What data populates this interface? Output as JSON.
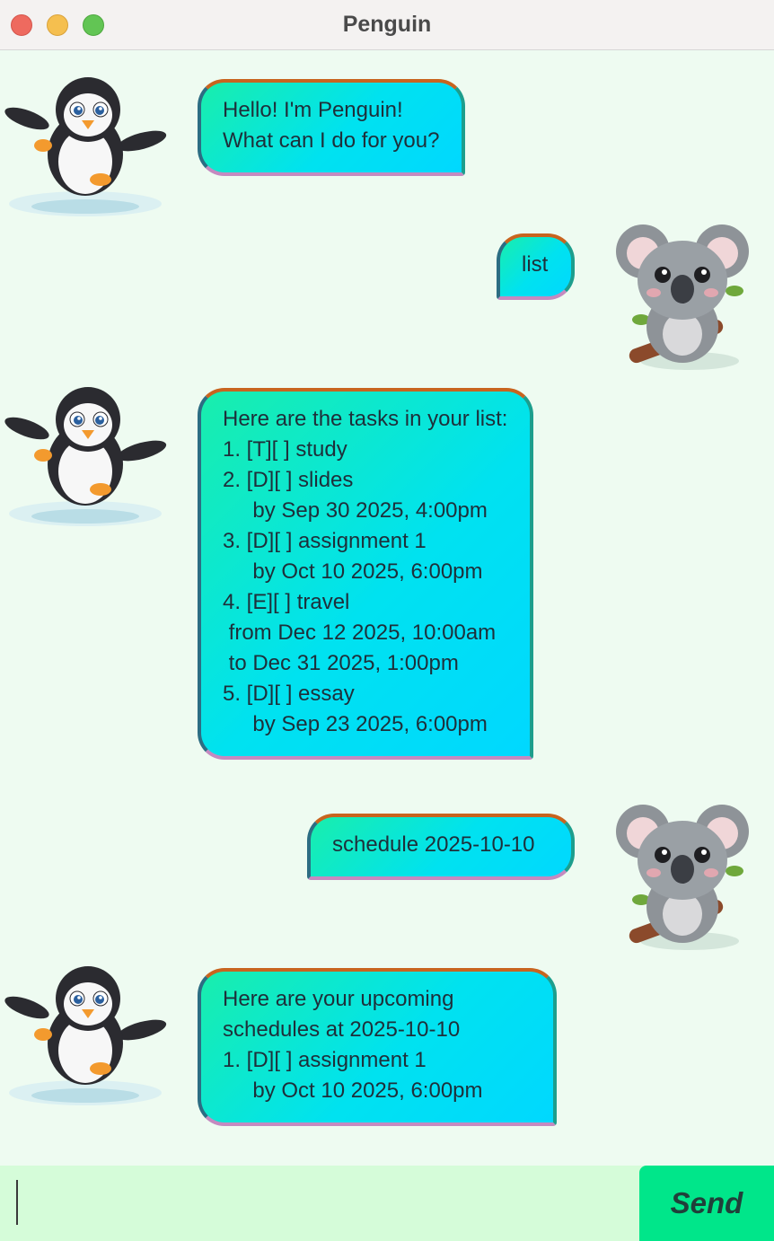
{
  "window": {
    "title": "Penguin"
  },
  "messages": [
    {
      "sender": "bot",
      "text": "Hello! I'm Penguin!\nWhat can I do for you?"
    },
    {
      "sender": "user",
      "text": "list"
    },
    {
      "sender": "bot",
      "text": "Here are the tasks in your list:\n1. [T][ ] study\n2. [D][ ] slides\n     by Sep 30 2025, 4:00pm\n3. [D][ ] assignment 1\n     by Oct 10 2025, 6:00pm\n4. [E][ ] travel\n from Dec 12 2025, 10:00am\n to Dec 31 2025, 1:00pm\n5. [D][ ] essay\n     by Sep 23 2025, 6:00pm"
    },
    {
      "sender": "user",
      "text": "schedule 2025-10-10"
    },
    {
      "sender": "bot",
      "text": "Here are your upcoming\nschedules at 2025-10-10\n1. [D][ ] assignment 1\n     by Oct 10 2025, 6:00pm"
    }
  ],
  "input": {
    "value": "",
    "placeholder": ""
  },
  "send_button": {
    "label": "Send"
  },
  "avatars": {
    "bot": "penguin-avatar",
    "user": "koala-avatar"
  },
  "colors": {
    "bubble_start": "#19eeac",
    "bubble_end": "#00d8ff",
    "send": "#00e68a",
    "background": "#eefbf1"
  }
}
